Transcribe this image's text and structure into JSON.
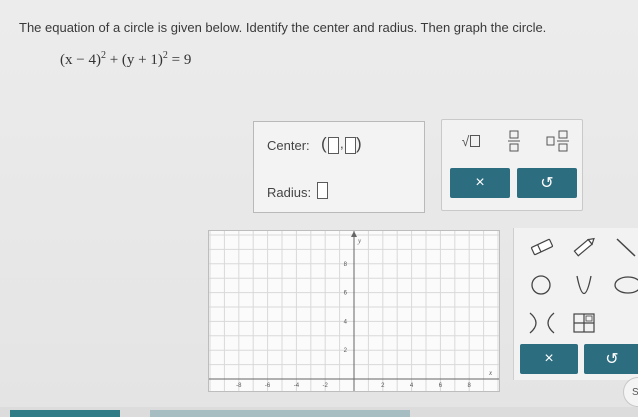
{
  "problem": {
    "prompt": "The equation of a circle is given below. Identify the center and radius. Then graph the circle.",
    "equation_part1": "(x − 4)",
    "exp1": "2",
    "equation_part2": " + (y + 1)",
    "exp2": "2",
    "equation_part3": " = 9"
  },
  "answer": {
    "center_label": "Center:",
    "radius_label": "Radius:",
    "open_paren": "(",
    "comma": ",",
    "close_paren": ")"
  },
  "keypad": {
    "sqrt_symbol": "√",
    "clear_label": "×",
    "undo_label": "↺"
  },
  "graph": {
    "x_ticks": [
      "-8",
      "-6",
      "-4",
      "-2",
      "2",
      "4",
      "6",
      "8"
    ],
    "y_ticks": [
      "8",
      "6",
      "4",
      "2"
    ],
    "y_axis_label": "y",
    "x_axis_label": "x"
  },
  "graph_tools": {
    "clear_label": "×",
    "undo_label": "↺"
  },
  "corner": {
    "label": "S"
  },
  "colors": {
    "accent": "#2d6d80",
    "grid": "#d9d9d9"
  }
}
